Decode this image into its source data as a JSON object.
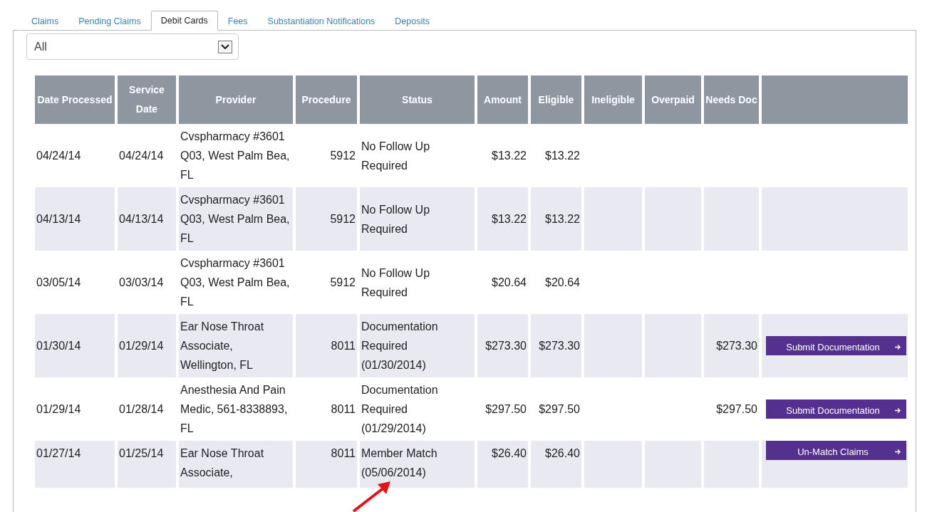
{
  "tabs": [
    {
      "label": "Claims",
      "selected": false
    },
    {
      "label": "Pending Claims",
      "selected": false
    },
    {
      "label": "Debit Cards",
      "selected": true
    },
    {
      "label": "Fees",
      "selected": false
    },
    {
      "label": "Substantiation Notifications",
      "selected": false
    },
    {
      "label": "Deposits",
      "selected": false
    }
  ],
  "filter": {
    "value": "All"
  },
  "table": {
    "columns": [
      "Date Processed",
      "Service Date",
      "Provider",
      "Procedure",
      "Status",
      "Amount",
      "Eligible",
      "Ineligible",
      "Overpaid",
      "Needs Doc"
    ],
    "rows": [
      {
        "cells": [
          "04/24/14",
          "04/24/14",
          "Cvspharmacy #3601 Q03, West Palm Bea, FL",
          "5912",
          "No Follow Up Required",
          "$13.22",
          "$13.22",
          "",
          "",
          ""
        ]
      },
      {
        "cells": [
          "04/13/14",
          "04/13/14",
          "Cvspharmacy #3601 Q03, West Palm Bea, FL",
          "5912",
          "No Follow Up Required",
          "$13.22",
          "$13.22",
          "",
          "",
          ""
        ]
      },
      {
        "cells": [
          "03/05/14",
          "03/03/14",
          "Cvspharmacy #3601 Q03, West Palm Bea, FL",
          "5912",
          "No Follow Up Required",
          "$20.64",
          "$20.64",
          "",
          "",
          ""
        ]
      },
      {
        "cells": [
          "01/30/14",
          "01/29/14",
          "Ear Nose Throat Associate, Wellington, FL",
          "8011",
          "Documentation Required (01/30/2014)",
          "$273.30",
          "$273.30",
          "",
          "",
          "$273.30"
        ],
        "action": "Submit Documentation"
      },
      {
        "cells": [
          "01/29/14",
          "01/28/14",
          "Anesthesia And Pain Medic, 561-8338893, FL",
          "8011",
          "Documentation Required (01/29/2014)",
          "$297.50",
          "$297.50",
          "",
          "",
          "$297.50"
        ],
        "action": "Submit Documentation"
      },
      {
        "cells": [
          "01/27/14",
          "01/25/14",
          "Ear Nose Throat Associate,",
          "8011",
          "Member Match (05/06/2014)",
          "$26.40",
          "$26.40",
          "",
          "",
          ""
        ],
        "action": "Un-Match Claims"
      }
    ]
  }
}
